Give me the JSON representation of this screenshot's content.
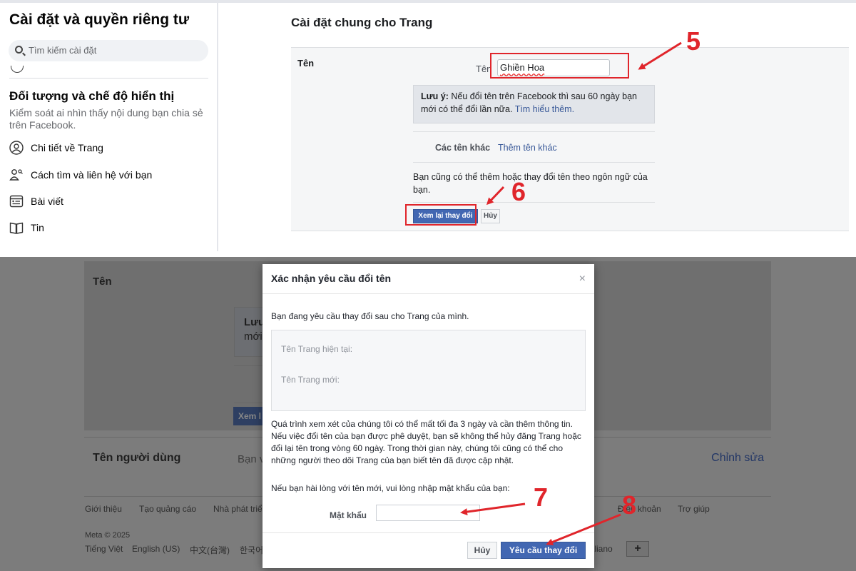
{
  "top": {
    "sidebar": {
      "title": "Cài đặt và quyền riêng tư",
      "search_placeholder": "Tìm kiếm cài đặt",
      "section_title": "Đối tượng và chế độ hiển thị",
      "section_desc": "Kiểm soát ai nhìn thấy nội dung bạn chia sẻ trên Facebook.",
      "items": [
        {
          "label": "Chi tiết về Trang",
          "icon": "user-circle-icon"
        },
        {
          "label": "Cách tìm và liên hệ với bạn",
          "icon": "find-contact-icon"
        },
        {
          "label": "Bài viết",
          "icon": "post-icon"
        },
        {
          "label": "Tin",
          "icon": "book-icon"
        }
      ]
    },
    "main": {
      "title": "Cài đặt chung cho Trang",
      "row_label": "Tên",
      "name_label": "Tên",
      "name_value": "Ghiền Hoa",
      "note_bold": "Lưu ý:",
      "note_text": " Nếu đổi tên trên Facebook thì sau 60 ngày bạn mới có thể đổi lần nữa. ",
      "note_link": "Tìm hiểu thêm.",
      "alt_names_label": "Các tên khác",
      "alt_names_link": "Thêm tên khác",
      "info_text": "Bạn cũng có thể thêm hoặc thay đổi tên theo ngôn ngữ của bạn.",
      "review_button": "Xem lại thay đổi",
      "cancel_button": "Hủy"
    }
  },
  "bottom": {
    "background": {
      "row_label": "Tên",
      "note_bold_partial": "Lưu",
      "note_text_partial": "mới",
      "button_partial": "Xem l",
      "username_label": "Tên người dùng",
      "username_value_partial": "Bạn v",
      "edit_link": "Chỉnh sửa",
      "footer_links": [
        "Giới thiệu",
        "Tạo quảng cáo",
        "Nhà phát triể",
        "Điều khoản",
        "Trợ giúp"
      ],
      "copyright": "Meta © 2025",
      "languages": [
        "Tiếng Việt",
        "English (US)",
        "中文(台灣)",
        "한국어",
        "Italiano"
      ],
      "add_language": "+"
    },
    "dialog": {
      "title": "Xác nhận yêu cầu đổi tên",
      "close": "×",
      "intro": "Bạn đang yêu cầu thay đổi sau cho Trang của mình.",
      "current_name_label": "Tên Trang hiện tại:",
      "new_name_label": "Tên Trang mới:",
      "body": "Quá trình xem xét của chúng tôi có thể mất tối đa 3 ngày và cần thêm thông tin. Nếu việc đổi tên của bạn được phê duyệt, bạn sẽ không thể hủy đăng Trang hoặc đổi lại tên trong vòng 60 ngày. Trong thời gian này, chúng tôi cũng có thể cho những người theo dõi Trang của bạn biết tên đã được cập nhật.",
      "password_prompt": "Nếu bạn hài lòng với tên mới, vui lòng nhập mật khẩu của bạn:",
      "password_label": "Mật khẩu",
      "cancel_button": "Hủy",
      "submit_button": "Yêu cầu thay đổi"
    }
  },
  "annotations": {
    "steps": [
      "5",
      "6",
      "7",
      "8"
    ],
    "color": "#e0252b"
  }
}
